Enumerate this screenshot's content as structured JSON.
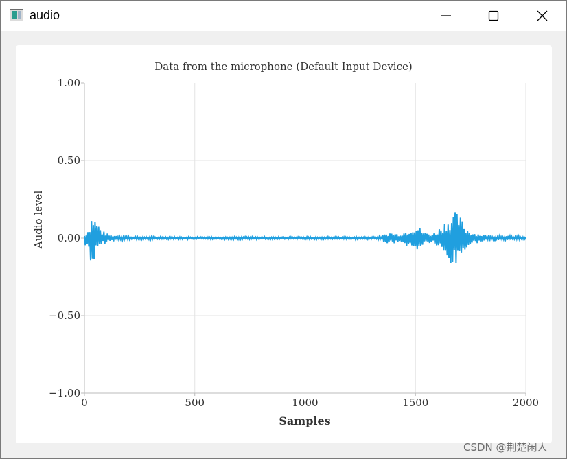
{
  "window": {
    "title": "audio"
  },
  "titlebar": {
    "icons": [
      "app-icon",
      "minimize-icon",
      "maximize-icon",
      "close-icon"
    ]
  },
  "chart_data": {
    "type": "line",
    "title": "Data from the microphone (Default Input Device)",
    "xlabel": "Samples",
    "ylabel": "Audio level",
    "xlim": [
      0,
      2000
    ],
    "ylim": [
      -1.0,
      1.0
    ],
    "x_ticks": [
      "0",
      "500",
      "1000",
      "1500",
      "2000"
    ],
    "y_ticks": [
      "1.00",
      "0.50",
      "0.00",
      "−0.50",
      "−1.00"
    ],
    "grid": true,
    "line_color": "#209fdf",
    "envelope": {
      "x": [
        0,
        20,
        35,
        50,
        80,
        110,
        160,
        220,
        400,
        800,
        1200,
        1340,
        1380,
        1420,
        1460,
        1490,
        1510,
        1540,
        1580,
        1610,
        1650,
        1680,
        1700,
        1730,
        1760,
        1800,
        1900,
        2000
      ],
      "upper": [
        0.02,
        0.07,
        0.17,
        0.13,
        0.05,
        0.025,
        0.015,
        0.01,
        0.008,
        0.008,
        0.008,
        0.01,
        0.04,
        0.03,
        0.05,
        0.09,
        0.08,
        0.04,
        0.03,
        0.07,
        0.14,
        0.17,
        0.15,
        0.07,
        0.04,
        0.025,
        0.015,
        0.01
      ],
      "lower": [
        -0.06,
        -0.08,
        -0.22,
        -0.12,
        -0.05,
        -0.025,
        -0.015,
        -0.01,
        -0.008,
        -0.008,
        -0.008,
        -0.01,
        -0.04,
        -0.03,
        -0.05,
        -0.09,
        -0.08,
        -0.04,
        -0.03,
        -0.08,
        -0.18,
        -0.2,
        -0.14,
        -0.07,
        -0.04,
        -0.025,
        -0.015,
        -0.01
      ]
    }
  },
  "watermark": "CSDN @荆楚闲人"
}
